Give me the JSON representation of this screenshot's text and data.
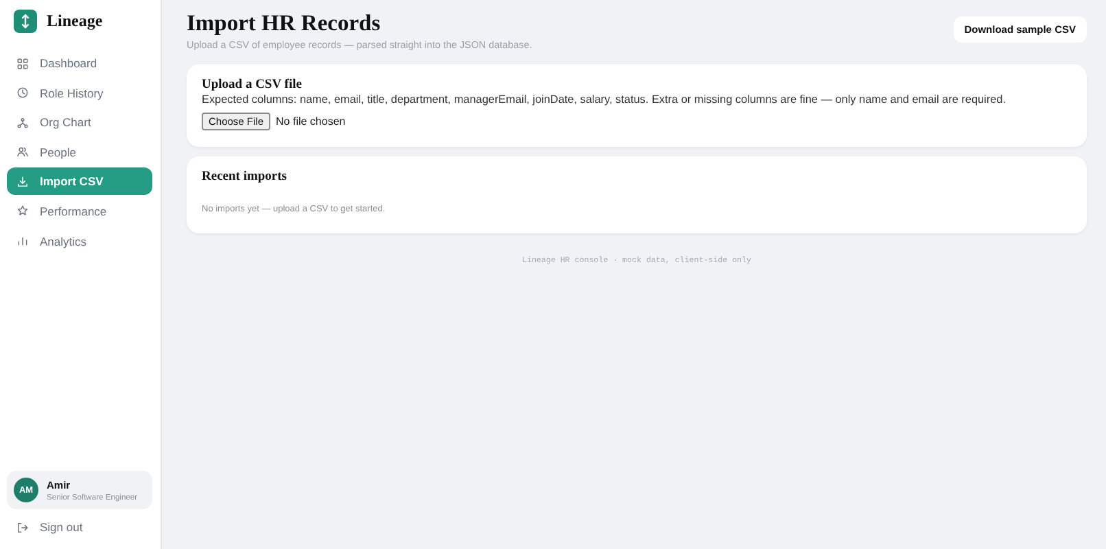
{
  "brand": {
    "name": "Lineage"
  },
  "nav": [
    {
      "label": "Dashboard",
      "selected": false
    },
    {
      "label": "Role History",
      "selected": false
    },
    {
      "label": "Org Chart",
      "selected": false
    },
    {
      "label": "People",
      "selected": false
    },
    {
      "label": "Import CSV",
      "selected": true
    },
    {
      "label": "Performance",
      "selected": false
    },
    {
      "label": "Analytics",
      "selected": false
    }
  ],
  "user": {
    "initials": "AM",
    "name": "Amir",
    "role": "Senior Software Engineer"
  },
  "sign_out": "Sign out",
  "header": {
    "title": "Import HR Records",
    "subtitle": "Upload a CSV of employee records — parsed straight into the JSON database.",
    "action": "Download sample CSV"
  },
  "upload": {
    "title": "Upload a CSV file",
    "description": "Expected columns: name, email, title, department, managerEmail, joinDate, salary, status. Extra or missing columns are fine — only name and email are required.",
    "button": "Choose File",
    "status": "No file chosen"
  },
  "recent": {
    "title": "Recent imports",
    "empty": "No imports yet — upload a CSV to get started."
  },
  "footer": "Lineage HR console · mock data, client-side only"
}
